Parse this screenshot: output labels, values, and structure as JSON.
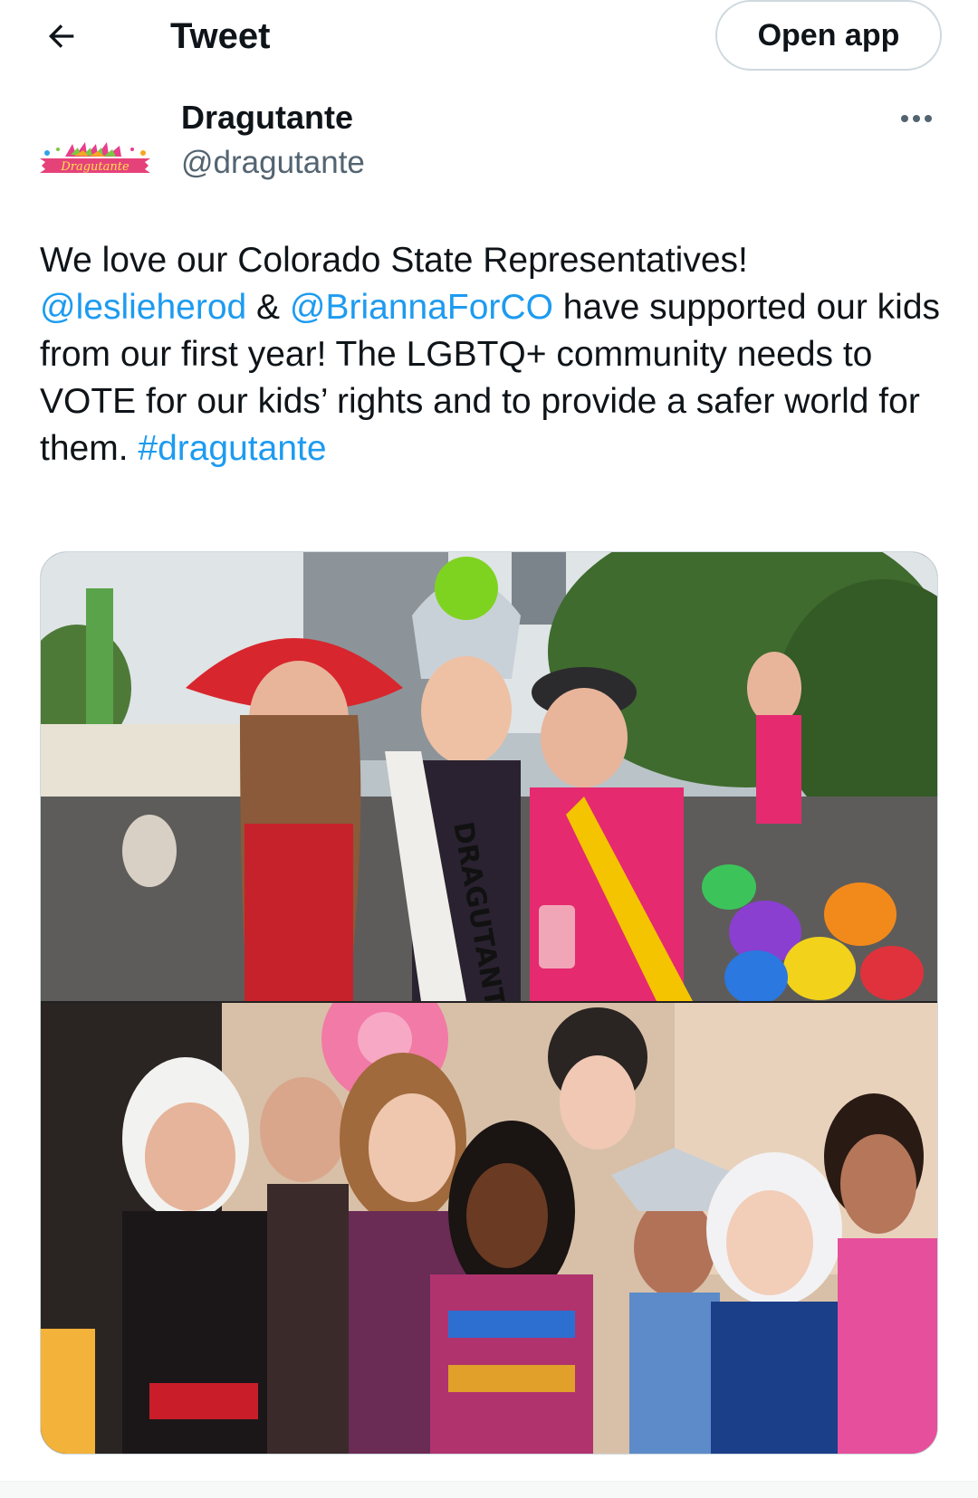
{
  "header": {
    "back_icon": "arrow-left-icon",
    "title": "Tweet",
    "open_app_label": "Open app"
  },
  "author": {
    "display_name": "Dragutante",
    "handle": "@dragutante",
    "avatar_text": "Dragutante",
    "more_icon": "more-horizontal-icon"
  },
  "tweet": {
    "text_1": "We love our Colorado State Representatives! ",
    "mention_1": "@leslieherod",
    "text_2": " & ",
    "mention_2": "@BriannaForCO",
    "text_3": " have supported our kids from our first year! The LGBTQ+ community needs to VOTE for our kids’ rights and to provide a safer world for them. ",
    "hashtag": "#dragutante",
    "sash_text": "DRAGUTANTE"
  },
  "colors": {
    "link": "#1d9bf0",
    "text": "#0f1419",
    "secondary": "#536471",
    "border": "#cfd9de"
  }
}
